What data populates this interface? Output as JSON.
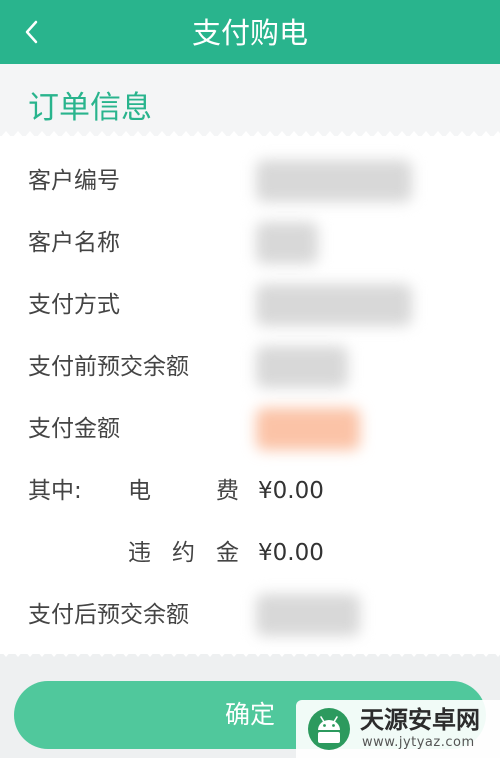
{
  "header": {
    "title": "支付购电",
    "back_icon": "chevron-left-icon"
  },
  "section": {
    "title": "订单信息"
  },
  "rows": {
    "customer_id": {
      "label": "客户编号"
    },
    "customer_name": {
      "label": "客户名称"
    },
    "payment_method": {
      "label": "支付方式"
    },
    "balance_before": {
      "label": "支付前预交余额"
    },
    "pay_amount": {
      "label": "支付金额"
    },
    "breakdown": {
      "label": "其中:",
      "electricity": {
        "chars": [
          "电",
          "费"
        ],
        "amount": "¥0.00"
      },
      "penalty": {
        "chars": [
          "违",
          "约",
          "金"
        ],
        "amount": "¥0.00"
      }
    },
    "balance_after": {
      "label": "支付后预交余额"
    }
  },
  "footer": {
    "confirm_label": "确定"
  },
  "watermark": {
    "name": "天源安卓网",
    "url": "www.jytyaz.com"
  },
  "colors": {
    "primary": "#29b48d",
    "button": "#50c89c",
    "background": "#eef0f1",
    "highlight": "#fbc3a7"
  }
}
